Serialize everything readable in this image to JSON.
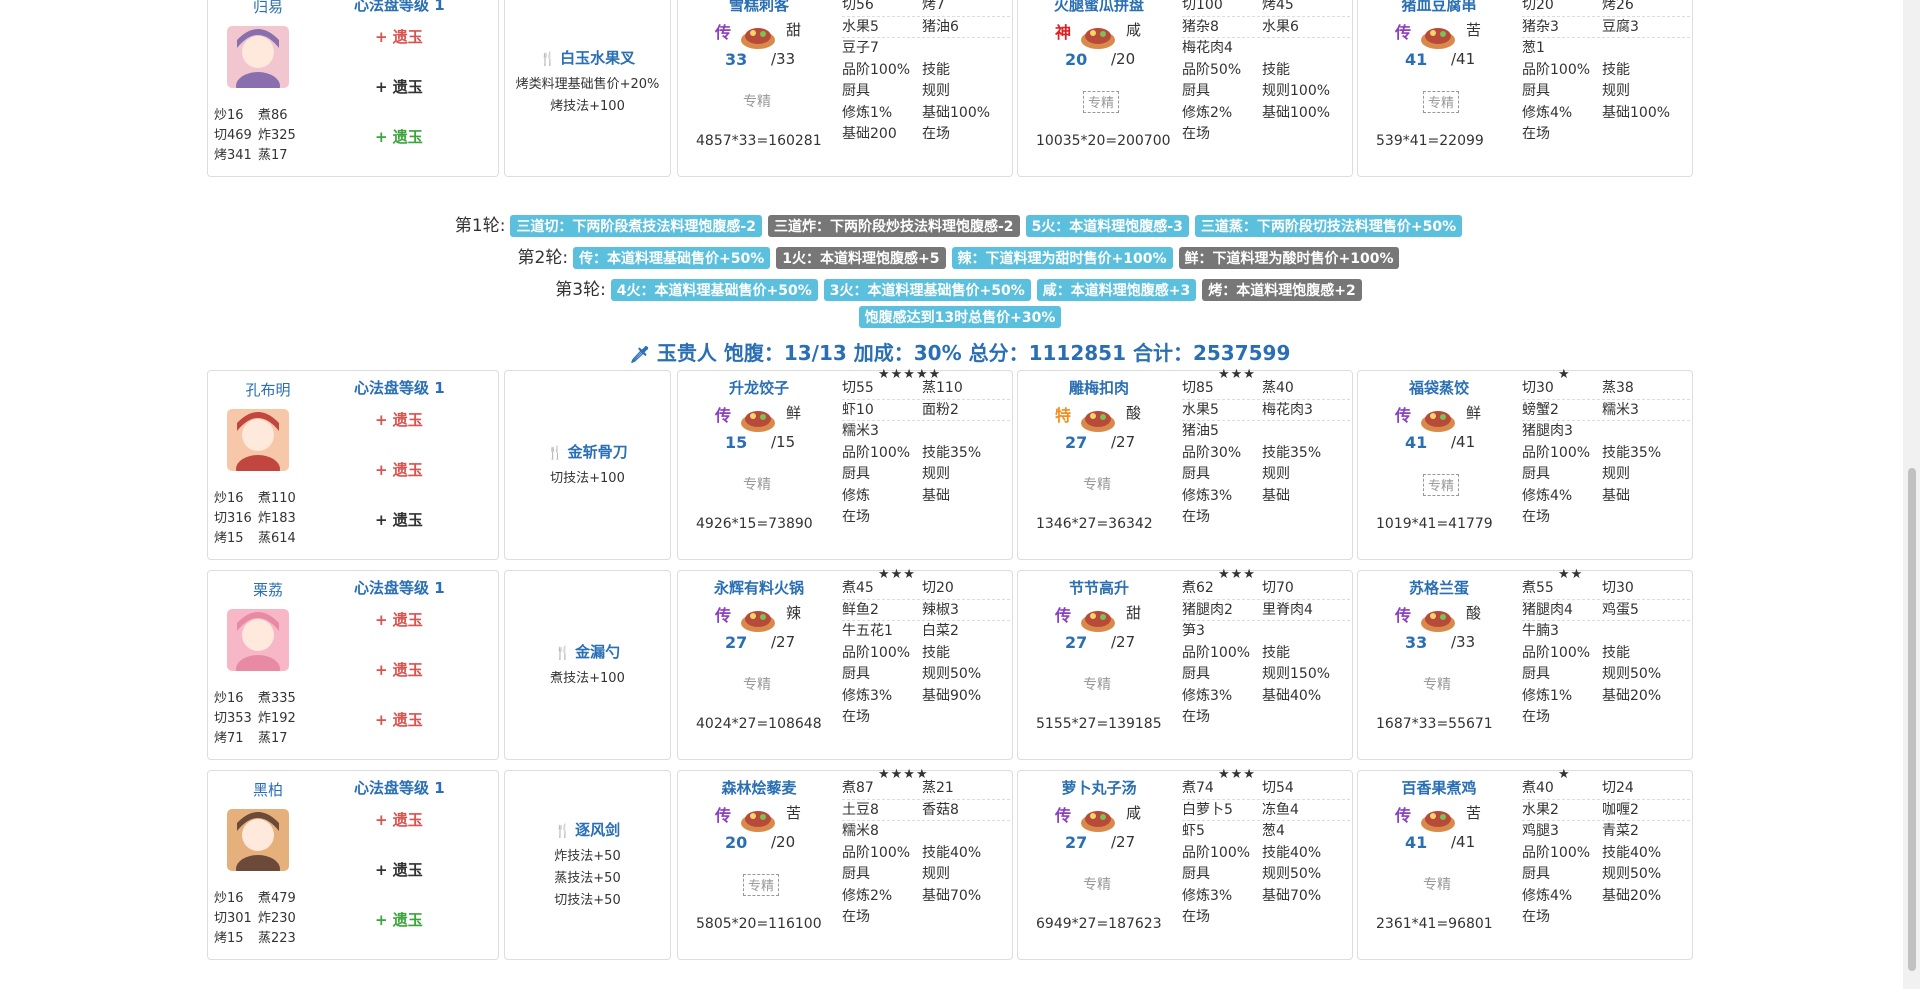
{
  "colors": {
    "blue_text": "#2a6fb4",
    "tag_blue": "#5bc0de",
    "tag_gray": "#777777",
    "red": "#d9534f",
    "green": "#3ca43c",
    "legend": "#8b3fbf",
    "god": "#e02020",
    "special": "#f09020"
  },
  "top_group": {
    "chef": {
      "name": "归易",
      "level": "心法盘等级 1",
      "skills": [
        "炒16",
        "煮86",
        "切469",
        "炸325",
        "烤341",
        "蒸17"
      ],
      "ambers": [
        {
          "label": "+ 遗玉",
          "color": "red"
        },
        {
          "label": "+ 遗玉",
          "color": "blue"
        },
        {
          "label": "+ 遗玉",
          "color": "green"
        }
      ]
    },
    "equip": {
      "name": "白玉水果叉",
      "icon": "fork-icon",
      "effects": [
        "烤类料理基础售价+20%",
        "烤技法+100"
      ]
    },
    "dishes": [
      {
        "name": "雪糕刺客",
        "stars": "★★",
        "rarity": "传",
        "rarity_color": "legend",
        "flavor": "甜",
        "qty": "33",
        "qty_max": "/33",
        "spec": "专精",
        "has_spec_img": false,
        "formula": "4857*33=160281",
        "grid": [
          [
            "切56",
            "烤7"
          ],
          [
            "水果5",
            "猪油6"
          ],
          [
            "豆子7",
            ""
          ],
          [
            "品阶100%",
            "技能"
          ],
          [
            "厨具",
            "规则"
          ],
          [
            "修炼1%",
            "基础100%"
          ],
          [
            "基础200",
            "在场"
          ]
        ]
      },
      {
        "name": "火腿蜜瓜拼盘",
        "stars": "★★★★",
        "rarity": "神",
        "rarity_color": "god",
        "flavor": "咸",
        "qty": "20",
        "qty_max": "/20",
        "spec": "专精",
        "has_spec_img": true,
        "formula": "10035*20=200700",
        "grid": [
          [
            "切100",
            "烤45"
          ],
          [
            "猪杂8",
            "水果6"
          ],
          [
            "梅花肉4",
            ""
          ],
          [
            "品阶50%",
            "技能"
          ],
          [
            "厨具",
            "规则100%"
          ],
          [
            "修炼2%",
            "基础100%"
          ],
          [
            "在场",
            ""
          ]
        ]
      },
      {
        "name": "猪血豆腐串",
        "stars": "★",
        "rarity": "传",
        "rarity_color": "legend",
        "flavor": "苦",
        "qty": "41",
        "qty_max": "/41",
        "spec": "专精",
        "has_spec_img": true,
        "formula": "539*41=22099",
        "grid": [
          [
            "切20",
            "烤26"
          ],
          [
            "猪杂3",
            "豆腐3"
          ],
          [
            "葱1",
            ""
          ],
          [
            "品阶100%",
            "技能"
          ],
          [
            "厨具",
            "规则"
          ],
          [
            "修炼4%",
            "基础100%"
          ],
          [
            "在场",
            ""
          ]
        ]
      }
    ]
  },
  "rounds": [
    {
      "label": "第1轮:",
      "tags": [
        {
          "text": "三道切：下两阶段煮技法料理饱腹感-2",
          "style": "blue"
        },
        {
          "text": "三道炸：下两阶段炒技法料理饱腹感-2",
          "style": "gray"
        },
        {
          "text": "5火：本道料理饱腹感-3",
          "style": "blue"
        },
        {
          "text": "三道蒸：下两阶段切技法料理售价+50%",
          "style": "blue"
        }
      ]
    },
    {
      "label": "第2轮:",
      "tags": [
        {
          "text": "传：本道料理基础售价+50%",
          "style": "blue"
        },
        {
          "text": "1火：本道料理饱腹感+5",
          "style": "gray"
        },
        {
          "text": "辣：下道料理为甜时售价+100%",
          "style": "blue"
        },
        {
          "text": "鲜：下道料理为酸时售价+100%",
          "style": "gray"
        }
      ]
    },
    {
      "label": "第3轮:",
      "tags": [
        {
          "text": "4火：本道料理基础售价+50%",
          "style": "blue"
        },
        {
          "text": "3火：本道料理基础售价+50%",
          "style": "blue"
        },
        {
          "text": "咸：本道料理饱腹感+3",
          "style": "blue"
        },
        {
          "text": "烤：本道料理饱腹感+2",
          "style": "gray"
        }
      ]
    },
    {
      "label": "",
      "tags": [
        {
          "text": "饱腹感达到13时总售价+30%",
          "style": "blue"
        }
      ]
    }
  ],
  "summary": "玉贵人 饱腹：13/13 加成：30% 总分：1112851 合计：2537599",
  "groups": [
    {
      "chef": {
        "name": "孔布明",
        "level": "心法盘等级 1",
        "skills": [
          "炒16",
          "煮110",
          "切316",
          "炸183",
          "烤15",
          "蒸614"
        ],
        "ambers": [
          {
            "label": "+ 遗玉",
            "color": "red"
          },
          {
            "label": "+ 遗玉",
            "color": "red"
          },
          {
            "label": "+ 遗玉",
            "color": "blue"
          }
        ]
      },
      "equip": {
        "name": "金斩骨刀",
        "icon": "cleaver-icon",
        "effects": [
          "切技法+100"
        ]
      },
      "dishes": [
        {
          "name": "升龙饺子",
          "stars": "★★★★★",
          "rarity": "传",
          "rarity_color": "legend",
          "flavor": "鲜",
          "qty": "15",
          "qty_max": "/15",
          "spec": "专精",
          "has_spec_img": false,
          "formula": "4926*15=73890",
          "grid": [
            [
              "切55",
              "蒸110"
            ],
            [
              "虾10",
              "面粉2"
            ],
            [
              "糯米3",
              ""
            ],
            [
              "品阶100%",
              "技能35%"
            ],
            [
              "厨具",
              "规则"
            ],
            [
              "修炼",
              "基础"
            ],
            [
              "在场",
              ""
            ]
          ]
        },
        {
          "name": "雕梅扣肉",
          "stars": "★★★",
          "rarity": "特",
          "rarity_color": "special",
          "flavor": "酸",
          "qty": "27",
          "qty_max": "/27",
          "spec": "专精",
          "has_spec_img": false,
          "formula": "1346*27=36342",
          "grid": [
            [
              "切85",
              "蒸40"
            ],
            [
              "水果5",
              "梅花肉3"
            ],
            [
              "猪油5",
              ""
            ],
            [
              "品阶30%",
              "技能35%"
            ],
            [
              "厨具",
              "规则"
            ],
            [
              "修炼3%",
              "基础"
            ],
            [
              "在场",
              ""
            ]
          ]
        },
        {
          "name": "福袋蒸饺",
          "stars": "★",
          "rarity": "传",
          "rarity_color": "legend",
          "flavor": "鲜",
          "qty": "41",
          "qty_max": "/41",
          "spec": "专精",
          "has_spec_img": true,
          "formula": "1019*41=41779",
          "grid": [
            [
              "切30",
              "蒸38"
            ],
            [
              "螃蟹2",
              "糯米3"
            ],
            [
              "猪腿肉3",
              ""
            ],
            [
              "品阶100%",
              "技能35%"
            ],
            [
              "厨具",
              "规则"
            ],
            [
              "修炼4%",
              "基础"
            ],
            [
              "在场",
              ""
            ]
          ]
        }
      ]
    },
    {
      "chef": {
        "name": "栗荔",
        "level": "心法盘等级 1",
        "skills": [
          "炒16",
          "煮335",
          "切353",
          "炸192",
          "烤71",
          "蒸17"
        ],
        "ambers": [
          {
            "label": "+ 遗玉",
            "color": "red"
          },
          {
            "label": "+ 遗玉",
            "color": "red"
          },
          {
            "label": "+ 遗玉",
            "color": "red"
          }
        ]
      },
      "equip": {
        "name": "金漏勺",
        "icon": "ladle-icon",
        "effects": [
          "煮技法+100"
        ]
      },
      "dishes": [
        {
          "name": "永辉有料火锅",
          "stars": "★★★",
          "rarity": "传",
          "rarity_color": "legend",
          "flavor": "辣",
          "qty": "27",
          "qty_max": "/27",
          "spec": "专精",
          "has_spec_img": false,
          "formula": "4024*27=108648",
          "grid": [
            [
              "煮45",
              "切20"
            ],
            [
              "鲜鱼2",
              "辣椒3"
            ],
            [
              "牛五花1",
              "白菜2"
            ],
            [
              "品阶100%",
              "技能"
            ],
            [
              "厨具",
              "规则50%"
            ],
            [
              "修炼3%",
              "基础90%"
            ],
            [
              "在场",
              ""
            ]
          ]
        },
        {
          "name": "节节高升",
          "stars": "★★★",
          "rarity": "传",
          "rarity_color": "legend",
          "flavor": "甜",
          "qty": "27",
          "qty_max": "/27",
          "spec": "专精",
          "has_spec_img": false,
          "formula": "5155*27=139185",
          "grid": [
            [
              "煮62",
              "切70"
            ],
            [
              "猪腿肉2",
              "里脊肉4"
            ],
            [
              "笋3",
              ""
            ],
            [
              "品阶100%",
              "技能"
            ],
            [
              "厨具",
              "规则150%"
            ],
            [
              "修炼3%",
              "基础40%"
            ],
            [
              "在场",
              ""
            ]
          ]
        },
        {
          "name": "苏格兰蛋",
          "stars": "★★",
          "rarity": "传",
          "rarity_color": "legend",
          "flavor": "酸",
          "qty": "33",
          "qty_max": "/33",
          "spec": "专精",
          "has_spec_img": false,
          "formula": "1687*33=55671",
          "grid": [
            [
              "煮55",
              "切30"
            ],
            [
              "猪腿肉4",
              "鸡蛋5"
            ],
            [
              "牛腩3",
              ""
            ],
            [
              "品阶100%",
              "技能"
            ],
            [
              "厨具",
              "规则50%"
            ],
            [
              "修炼1%",
              "基础20%"
            ],
            [
              "在场",
              ""
            ]
          ]
        }
      ]
    },
    {
      "chef": {
        "name": "黑柏",
        "level": "心法盘等级 1",
        "skills": [
          "炒16",
          "煮479",
          "切301",
          "炸230",
          "烤15",
          "蒸223"
        ],
        "ambers": [
          {
            "label": "+ 遗玉",
            "color": "red"
          },
          {
            "label": "+ 遗玉",
            "color": "blue"
          },
          {
            "label": "+ 遗玉",
            "color": "green"
          }
        ]
      },
      "equip": {
        "name": "逐风剑",
        "icon": "sword-icon",
        "effects": [
          "炸技法+50",
          "蒸技法+50",
          "切技法+50"
        ]
      },
      "dishes": [
        {
          "name": "森林烩藜麦",
          "stars": "★★★★",
          "rarity": "传",
          "rarity_color": "legend",
          "flavor": "苦",
          "qty": "20",
          "qty_max": "/20",
          "spec": "专精",
          "has_spec_img": true,
          "formula": "5805*20=116100",
          "grid": [
            [
              "煮87",
              "蒸21"
            ],
            [
              "土豆8",
              "香菇8"
            ],
            [
              "糯米8",
              ""
            ],
            [
              "品阶100%",
              "技能40%"
            ],
            [
              "厨具",
              "规则"
            ],
            [
              "修炼2%",
              "基础70%"
            ],
            [
              "在场",
              ""
            ]
          ]
        },
        {
          "name": "萝卜丸子汤",
          "stars": "★★★",
          "rarity": "传",
          "rarity_color": "legend",
          "flavor": "咸",
          "qty": "27",
          "qty_max": "/27",
          "spec": "专精",
          "has_spec_img": false,
          "formula": "6949*27=187623",
          "grid": [
            [
              "煮74",
              "切54"
            ],
            [
              "白萝卜5",
              "冻鱼4"
            ],
            [
              "虾5",
              "葱4"
            ],
            [
              "品阶100%",
              "技能40%"
            ],
            [
              "厨具",
              "规则50%"
            ],
            [
              "修炼3%",
              "基础70%"
            ],
            [
              "在场",
              ""
            ]
          ]
        },
        {
          "name": "百香果煮鸡",
          "stars": "★",
          "rarity": "传",
          "rarity_color": "legend",
          "flavor": "苦",
          "qty": "41",
          "qty_max": "/41",
          "spec": "专精",
          "has_spec_img": false,
          "formula": "2361*41=96801",
          "grid": [
            [
              "煮40",
              "切24"
            ],
            [
              "水果2",
              "咖喱2"
            ],
            [
              "鸡腿3",
              "青菜2"
            ],
            [
              "品阶100%",
              "技能40%"
            ],
            [
              "厨具",
              "规则50%"
            ],
            [
              "修炼4%",
              "基础20%"
            ],
            [
              "在场",
              ""
            ]
          ]
        }
      ]
    }
  ]
}
